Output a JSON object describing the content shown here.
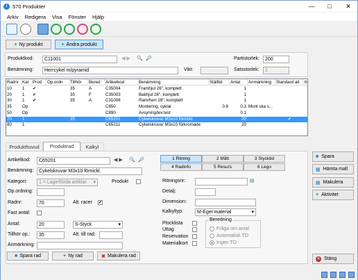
{
  "window": {
    "title": "570 Produkter"
  },
  "menu": [
    "Arkiv",
    "Redigera",
    "Visa",
    "Fönster",
    "Hjälp"
  ],
  "actions": {
    "new_product": "Ny produkt",
    "edit_product": "Ändra produkt"
  },
  "header": {
    "produktkod_label": "Produktkod:",
    "produktkod": "C11001",
    "benamning_label": "Benämning:",
    "benamning": "Herrcykel m/pyramid",
    "vikt_label": "Vikt:",
    "vikt": "",
    "partistorlek_label": "Partistorlek:",
    "partistorlek": "200",
    "satsstorlek_label": "Satsstorlek:",
    "satsstorlek": "1"
  },
  "grid": {
    "columns": [
      "Radnr",
      "Kat",
      "Prod",
      "Op.ordn",
      "Tillhör",
      "Bered",
      "Artikelkod",
      "Benämning",
      "Ställtid",
      "Antal",
      "Anmärkning",
      "Standard alt"
    ],
    "rows": [
      {
        "radnr": "10",
        "kat": "1",
        "prod": "✔",
        "opordn": "",
        "tillhor": "35",
        "bered": "A",
        "artikelkod": "C35004",
        "benamning": "Framhjul 26\", komplett",
        "stalltid": "",
        "antal": "1",
        "anm": "",
        "std": ""
      },
      {
        "radnr": "20",
        "kat": "1",
        "prod": "✔",
        "opordn": "",
        "tillhor": "35",
        "bered": "F",
        "artikelkod": "C35003",
        "benamning": "Bakhjul 26\", komplett",
        "stalltid": "",
        "antal": "1",
        "anm": "",
        "std": ""
      },
      {
        "radnr": "30",
        "kat": "1",
        "prod": "✔",
        "opordn": "",
        "tillhor": "35",
        "bered": "A",
        "artikelkod": "C31008",
        "benamning": "Ram/herr 28\", komplett",
        "stalltid": "",
        "antal": "1",
        "anm": "",
        "std": ""
      },
      {
        "radnr": "35",
        "kat": "Op",
        "prod": "",
        "opordn": "",
        "tillhor": "",
        "bered": "",
        "artikelkod": "C850",
        "benamning": "Montering, cyklar",
        "stalltid": "0.8",
        "antal": "0.3",
        "anm": "Mont ska s...",
        "std": ""
      },
      {
        "radnr": "50",
        "kat": "Op",
        "prod": "",
        "opordn": "",
        "tillhor": "",
        "bered": "",
        "artikelkod": "C890",
        "benamning": "Avsyning/lev.test",
        "stalltid": "",
        "antal": "0.1",
        "anm": "",
        "std": ""
      },
      {
        "radnr": "70",
        "kat": "1",
        "prod": "",
        "opordn": "",
        "tillhor": "35",
        "bered": "",
        "artikelkod": "C65201",
        "benamning": "Cykelskruvar M3x10 förnickl.",
        "stalltid": "",
        "antal": "20",
        "anm": "",
        "std": "✔"
      },
      {
        "radnr": "80",
        "kat": "1",
        "prod": "",
        "opordn": "",
        "tillhor": "",
        "bered": "",
        "artikelkod": "C65211",
        "benamning": "Cykelskruvar M3x10 förkromade",
        "stalltid": "",
        "antal": "20",
        "anm": "",
        "std": ""
      }
    ]
  },
  "tabs": [
    "Produkthuvud",
    "Produktrad",
    "Kalkyl"
  ],
  "form": {
    "artikelkod_label": "Artikelkod:",
    "artikelkod": "C65201",
    "benamning_label": "Benämning:",
    "benamning": "Cykelskruvar M3x10 förnickl.",
    "kategori_label": "Kategori:",
    "kategori": "1 = Lagerförda artiklar",
    "produkt_label": "Produkt",
    "opordning_label": "Op.ordning:",
    "radnr_label": "Radnr:",
    "radnr": "70",
    "altracer_label": "Alt. racer",
    "fastantal_label": "Fast antal:",
    "antal_label": "Antal:",
    "antal": "20",
    "enhet": "S-Styck",
    "tillhor_label": "Tillhör op.:",
    "tillhor": "35",
    "alttillrad_label": "Alt. till rad:",
    "anmarkning_label": "Anmärkning:"
  },
  "buttons": {
    "spara_rad": "Spara rad",
    "ny_rad": "Ny rad",
    "makulera_rad": "Makulera rad"
  },
  "rtabs": [
    "1 Ritning",
    "2 Mått",
    "3 Stycktid",
    "4 Radinfo",
    "5 Resurs",
    "6 Lego"
  ],
  "right": {
    "ritningsnr_label": "Ritningsnr:",
    "detalj_label": "Detalj:",
    "dimension_label": "Dimension:",
    "kalkyltyp_label": "Kalkyltyp:",
    "kalkyltyp": "M-Eget material",
    "plocklista": "Plocklista",
    "uttag": "Uttag",
    "reservation": "Reservation",
    "materialkort": "Materialkort",
    "beredning": "Beredning",
    "fraga": "Fråga om antal",
    "automatisk": "Automatisk TO",
    "ingen": "Ingen TO"
  },
  "side": {
    "spara": "Spara",
    "hamta": "Hämta mall",
    "makulera": "Makulera",
    "aktivitet": "Aktivitet",
    "stang": "Stäng"
  },
  "colors": {
    "selected_row": "#3399ff",
    "accent": "#2a7fd4"
  }
}
